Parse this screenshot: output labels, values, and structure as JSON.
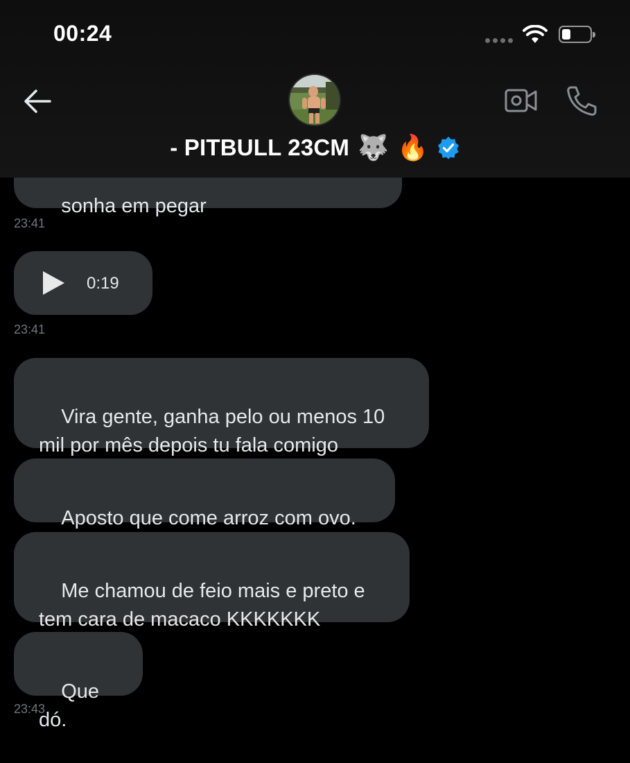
{
  "status_bar": {
    "time": "00:24"
  },
  "header": {
    "name": "- PITBULL 23CM",
    "emojis": [
      "🐺",
      "🔥"
    ],
    "verified": true,
    "icons": {
      "back": "back-arrow-icon",
      "video": "video-call-icon",
      "call": "phone-icon",
      "verified": "verified-badge-icon"
    }
  },
  "messages": [
    {
      "type": "text",
      "text": "sonha em pegar"
    },
    {
      "type": "timestamp",
      "text": "23:41"
    },
    {
      "type": "audio",
      "duration": "0:19"
    },
    {
      "type": "timestamp",
      "text": "23:41"
    },
    {
      "type": "text",
      "text": "Vira gente, ganha pelo ou menos 10\nmil por mês depois tu fala comigo"
    },
    {
      "type": "text",
      "text": "Aposto que come arroz com ovo."
    },
    {
      "type": "text",
      "text": "Me chamou de feio mais e preto e\ntem cara de macaco KKKKKKK"
    },
    {
      "type": "text",
      "text": "Que dó."
    },
    {
      "type": "timestamp",
      "text": "23:43"
    }
  ],
  "colors": {
    "bubble": "#2f3336",
    "text": "#e7e9ea",
    "timestamp": "#71767b",
    "verified": "#1d9bf0"
  }
}
